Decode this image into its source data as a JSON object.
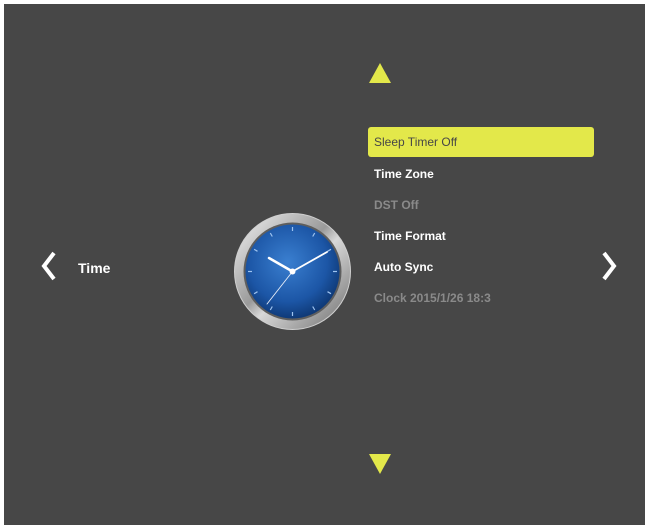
{
  "category": {
    "label": "Time",
    "prev_icon": "chevron-left-icon",
    "next_icon": "chevron-right-icon"
  },
  "nav": {
    "up_icon": "arrow-up-icon",
    "down_icon": "arrow-down-icon"
  },
  "clock_icon": "clock-icon",
  "menu": {
    "items": [
      {
        "label": "Sleep Timer Off",
        "state": "selected"
      },
      {
        "label": "Time Zone",
        "state": "enabled"
      },
      {
        "label": "DST Off",
        "state": "disabled"
      },
      {
        "label": "Time Format",
        "state": "enabled"
      },
      {
        "label": "Auto Sync",
        "state": "enabled"
      },
      {
        "label": "Clock 2015/1/26 18:3",
        "state": "disabled"
      }
    ]
  },
  "colors": {
    "background": "#474747",
    "accent": "#e3e84a",
    "text": "#ffffff",
    "disabled_text": "#8a8a8a"
  }
}
